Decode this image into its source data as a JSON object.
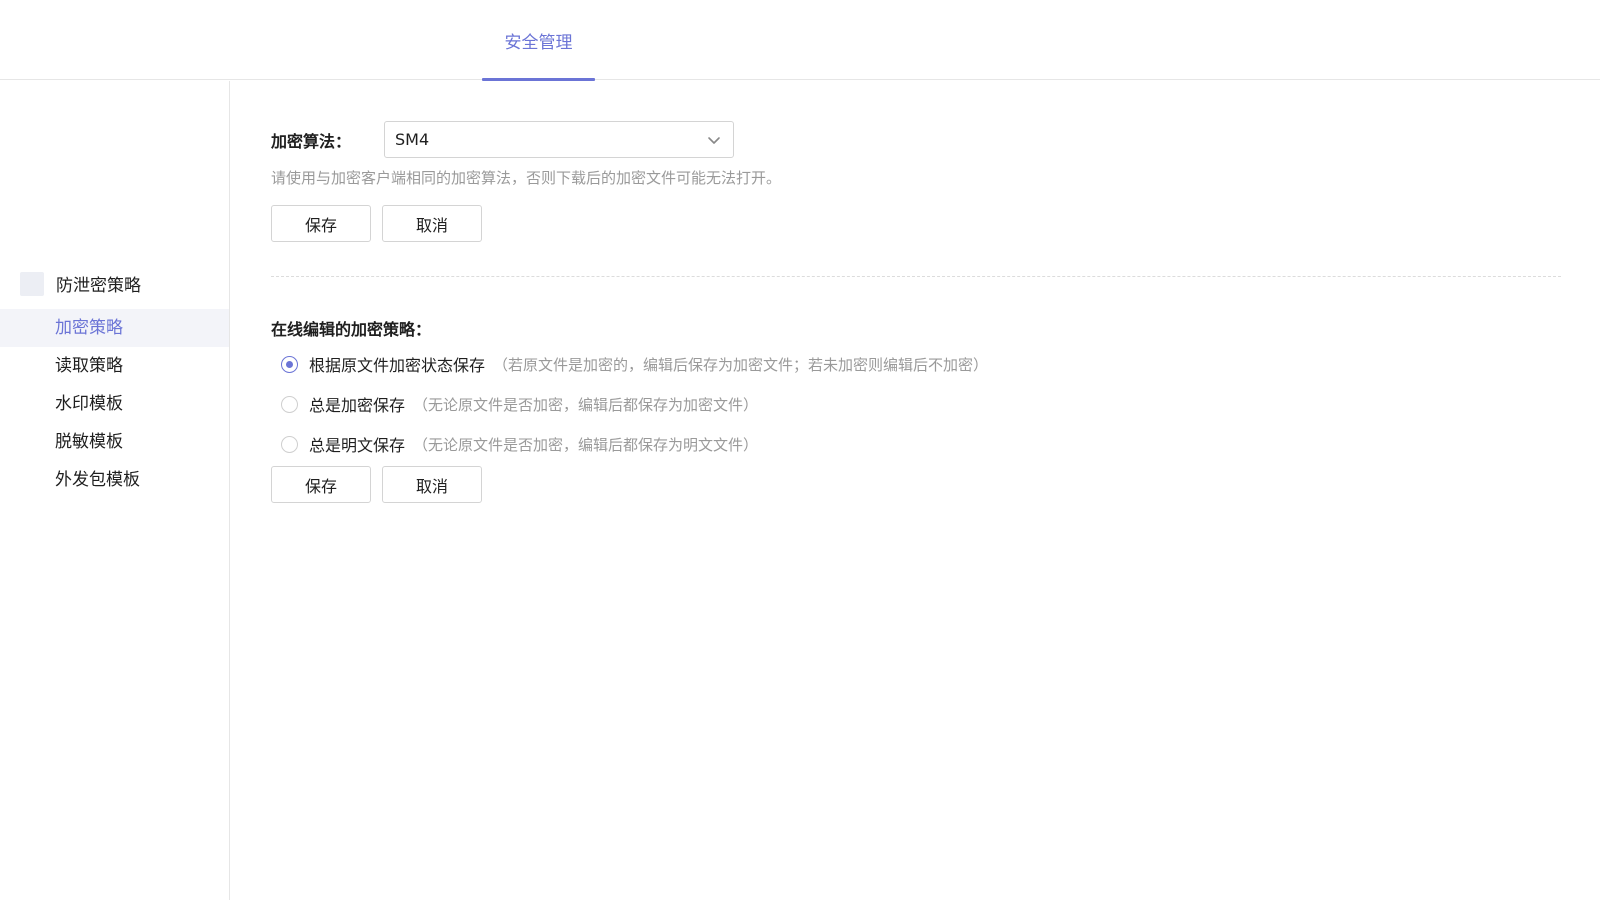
{
  "header": {
    "tabs": [
      {
        "label": "安全管理",
        "active": true
      }
    ]
  },
  "sidebar": {
    "group_label": "防泄密策略",
    "items": [
      {
        "label": "加密策略",
        "active": true
      },
      {
        "label": "读取策略"
      },
      {
        "label": "水印模板"
      },
      {
        "label": "脱敏模板"
      },
      {
        "label": "外发包模板"
      }
    ]
  },
  "algorithm_section": {
    "label": "加密算法：",
    "selected": "SM4",
    "hint": "请使用与加密客户端相同的加密算法，否则下载后的加密文件可能无法打开。",
    "save_label": "保存",
    "cancel_label": "取消"
  },
  "online_edit_section": {
    "title": "在线编辑的加密策略：",
    "options": [
      {
        "label": "根据原文件加密状态保存",
        "desc": "（若原文件是加密的，编辑后保存为加密文件；若未加密则编辑后不加密）",
        "checked": true
      },
      {
        "label": "总是加密保存",
        "desc": "（无论原文件是否加密，编辑后都保存为加密文件）",
        "checked": false
      },
      {
        "label": "总是明文保存",
        "desc": "（无论原文件是否加密，编辑后都保存为明文文件）",
        "checked": false
      }
    ],
    "save_label": "保存",
    "cancel_label": "取消"
  },
  "colors": {
    "accent": "#6b74d6",
    "hint_text": "#9a9a9a",
    "border": "#d4d4d4"
  }
}
